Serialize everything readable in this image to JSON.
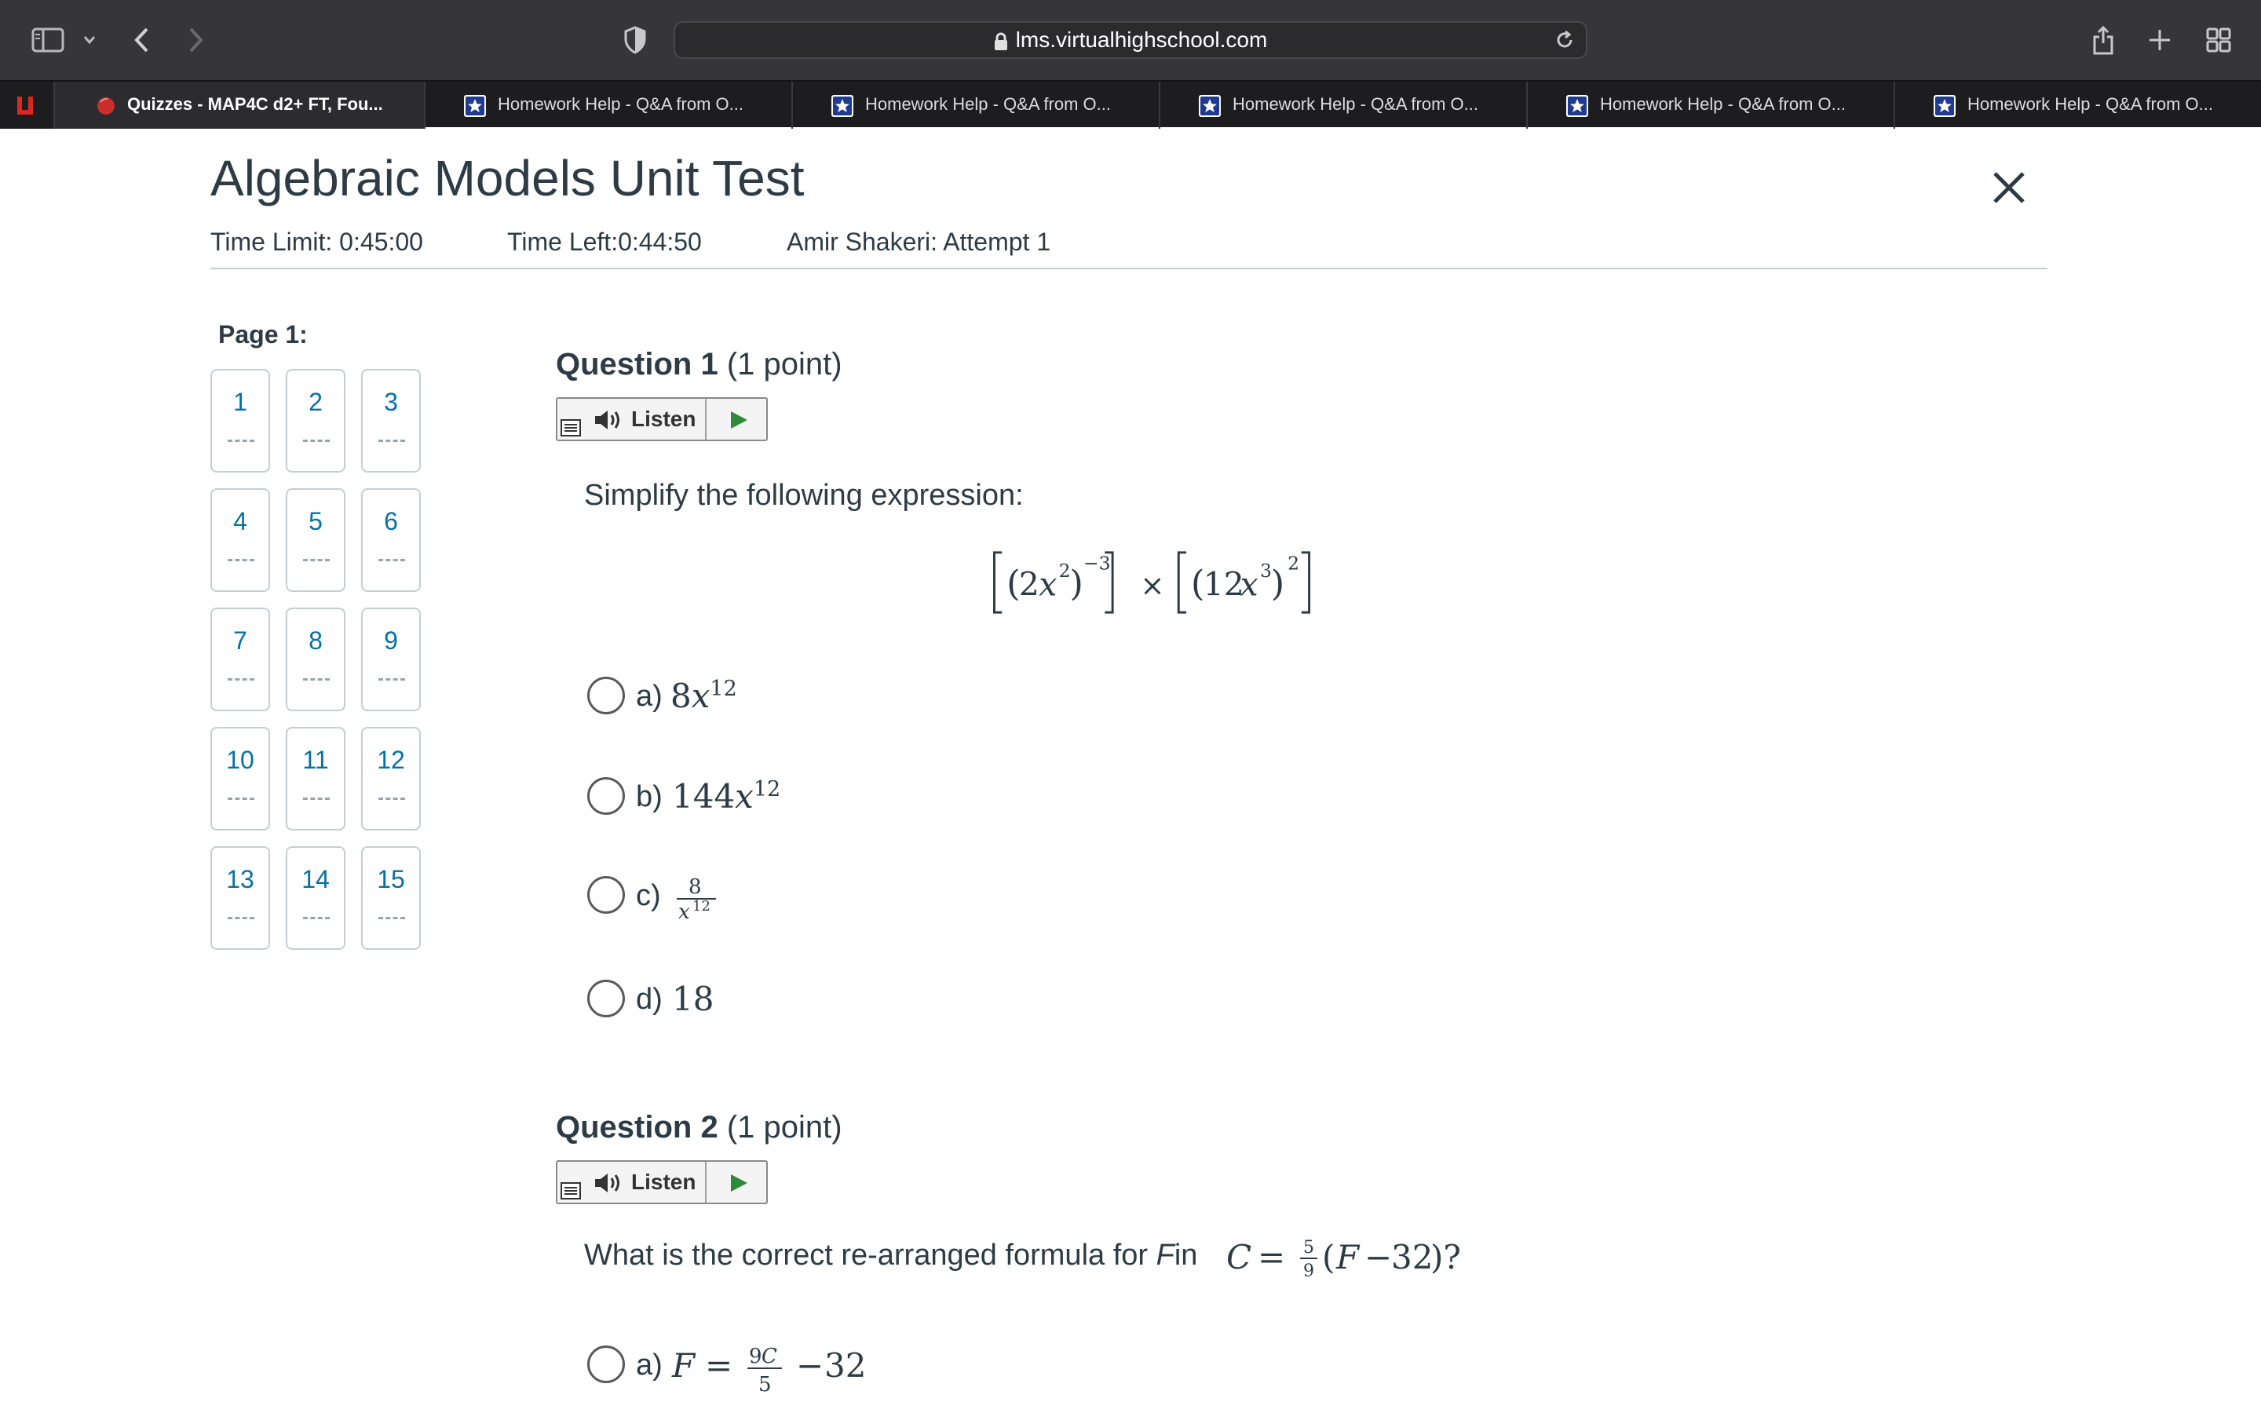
{
  "browser": {
    "url": "lms.virtualhighschool.com",
    "tabs": [
      {
        "label": "Quizzes - MAP4C d2+ FT, Fou...",
        "active": true
      },
      {
        "label": "Homework Help - Q&A from O...",
        "active": false
      },
      {
        "label": "Homework Help - Q&A from O...",
        "active": false
      },
      {
        "label": "Homework Help - Q&A from O...",
        "active": false
      },
      {
        "label": "Homework Help - Q&A from O...",
        "active": false
      },
      {
        "label": "Homework Help - Q&A from O...",
        "active": false
      }
    ],
    "colors": {
      "toolbar": "#36363a",
      "tabbar": "#1d1d1f",
      "pinned_logo": "#d52b1e",
      "favicon_blue": "#1f3a8f"
    }
  },
  "quiz": {
    "title": "Algebraic Models Unit Test",
    "time_limit": "Time Limit: 0:45:00",
    "time_left": "Time Left:0:44:50",
    "attempt": "Amir Shakeri: Attempt 1",
    "page_label": "Page 1:",
    "nav_numbers": [
      "1",
      "2",
      "3",
      "4",
      "5",
      "6",
      "7",
      "8",
      "9",
      "10",
      "11",
      "12",
      "13",
      "14",
      "15"
    ],
    "nav_status": "--",
    "listen_label": "Listen"
  },
  "questions": [
    {
      "heading": "Question 1",
      "points": "(1 point)",
      "prompt": "Simplify the following expression:",
      "options": [
        {
          "letter": "a)"
        },
        {
          "letter": "b)"
        },
        {
          "letter": "c)"
        },
        {
          "letter": "d)"
        }
      ]
    },
    {
      "heading": "Question 2",
      "points": "(1 point)",
      "prompt_before": "What is the correct re-arranged formula for",
      "prompt_var": "F",
      "prompt_in": "in",
      "options": [
        {
          "letter": "a)"
        }
      ]
    }
  ]
}
